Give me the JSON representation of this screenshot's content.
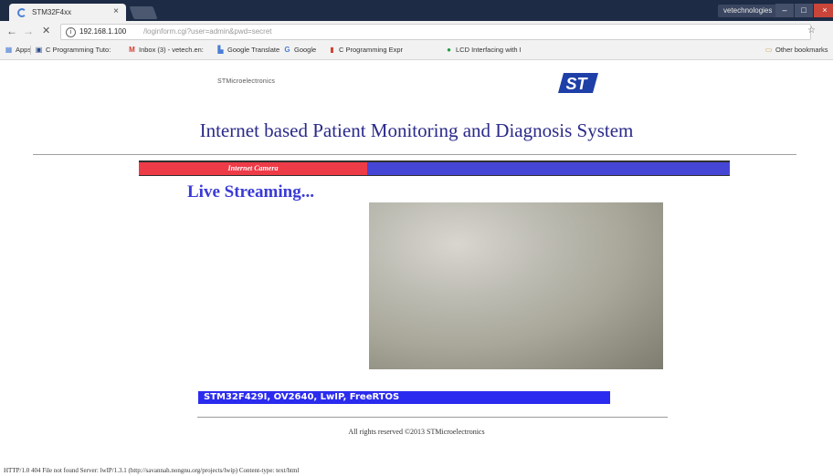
{
  "browser": {
    "tab_title": "STM32F4xx",
    "tab_close": "×",
    "profile_button": "vetechnologies",
    "minimize": "–",
    "maximize": "□",
    "close": "×",
    "back": "←",
    "forward": "→",
    "stop": "✕",
    "url_host": "192.168.1.100",
    "url_rest": "/loginform.cgi?user=admin&pwd=secret",
    "bookmarks": [
      {
        "icon": "apps-icon",
        "label": "Apps"
      },
      {
        "icon": "bookmark-icon",
        "label": "C Programming Tuto:"
      },
      {
        "icon": "gmail-icon",
        "label": "Inbox (3) - vetech.en:"
      },
      {
        "icon": "translate-icon",
        "label": "Google Translate"
      },
      {
        "icon": "google-icon",
        "label": "Google"
      },
      {
        "icon": "bookmark-icon",
        "label": "C Programming Expr"
      },
      {
        "icon": "bookmark-icon",
        "label": "LCD Interfacing with I"
      }
    ],
    "other_bookmarks": "Other bookmarks"
  },
  "page": {
    "company": "STMicroelectronics",
    "title": "Internet based Patient Monitoring and Diagnosis System",
    "camera_tab": "Internet Camera",
    "live_heading": "Live Streaming...",
    "bottom_bar": "STM32F429I, OV2640, LwIP, FreeRTOS",
    "footer": "All rights reserved ©2013 STMicroelectronics"
  },
  "status_text": "HTTP/1.0 404 File not found Server: lwIP/1.3.1 (http://savannah.nongnu.org/projects/lwip) Content-type: text/html",
  "colors": {
    "title_blue": "#2a2a8a",
    "camera_red": "#ee3b48",
    "camera_blue": "#4646d6",
    "bottom_bar_blue": "#2b2bef",
    "st_logo_blue": "#1f3fa8"
  }
}
